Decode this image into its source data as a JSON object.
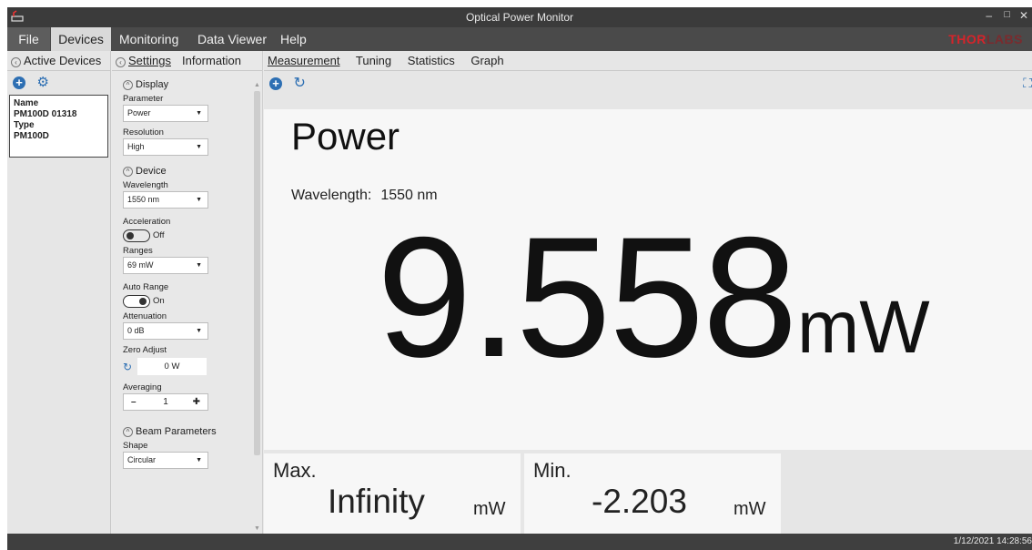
{
  "window": {
    "title": "Optical Power Monitor",
    "controls": {
      "minimize": "–",
      "maximize": "□",
      "close": "✕"
    }
  },
  "menu": {
    "items": [
      "File",
      "Devices",
      "Monitoring",
      "Data Viewer",
      "Help"
    ],
    "brand": "THOR",
    "brand_faded": "LABS"
  },
  "left_panel": {
    "header": "Active Devices",
    "device": {
      "name_label": "Name",
      "name": "PM100D 01318",
      "type_label": "Type",
      "type": "PM100D"
    }
  },
  "settings_panel": {
    "tabs": [
      "Settings",
      "Information"
    ],
    "display_section": "Display",
    "parameter_label": "Parameter",
    "parameter_value": "Power",
    "resolution_label": "Resolution",
    "resolution_value": "High",
    "device_section": "Device",
    "wavelength_label": "Wavelength",
    "wavelength_value": "1550 nm",
    "acceleration_label": "Acceleration",
    "acceleration_state": "Off",
    "ranges_label": "Ranges",
    "ranges_value": "69 mW",
    "auto_range_label": "Auto Range",
    "auto_range_state": "On",
    "attenuation_label": "Attenuation",
    "attenuation_value": "0 dB",
    "zero_adjust_label": "Zero Adjust",
    "zero_adjust_value": "0 W",
    "averaging_label": "Averaging",
    "averaging_value": "1",
    "beam_section": "Beam Parameters",
    "shape_label": "Shape",
    "shape_value": "Circular"
  },
  "main": {
    "tabs": [
      "Measurement",
      "Tuning",
      "Statistics",
      "Graph"
    ],
    "parameter_title": "Power",
    "wavelength_label": "Wavelength:",
    "wavelength_value": "1550 nm",
    "reading_value": "9.558",
    "reading_unit": "mW",
    "max_label": "Max.",
    "max_value": "Infinity",
    "max_unit": "mW",
    "min_label": "Min.",
    "min_value": "-2.203",
    "min_unit": "mW"
  },
  "status": {
    "timestamp": "1/12/2021 14:28:56"
  },
  "colors": {
    "accent_blue": "#2d6fb3",
    "brand_red": "#d6232a"
  }
}
